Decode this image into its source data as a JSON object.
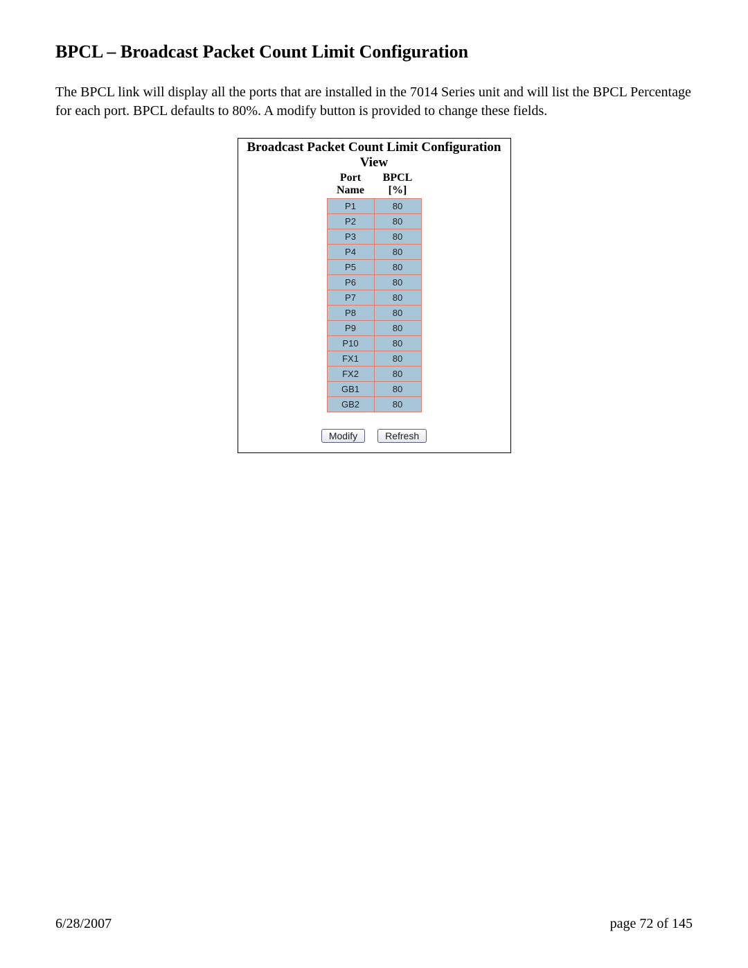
{
  "heading": "BPCL – Broadcast Packet Count Limit Configuration",
  "description": "The BPCL link will display all the ports that are installed in the 7014 Series unit and will list the BPCL Percentage for each port.  BPCL defaults to 80%. A modify button is provided to change these fields.",
  "panel": {
    "title": "Broadcast Packet Count Limit Configuration View",
    "columns": {
      "port": "Port Name",
      "bpcl": "BPCL [%]"
    },
    "rows": [
      {
        "port": "P1",
        "bpcl": "80"
      },
      {
        "port": "P2",
        "bpcl": "80"
      },
      {
        "port": "P3",
        "bpcl": "80"
      },
      {
        "port": "P4",
        "bpcl": "80"
      },
      {
        "port": "P5",
        "bpcl": "80"
      },
      {
        "port": "P6",
        "bpcl": "80"
      },
      {
        "port": "P7",
        "bpcl": "80"
      },
      {
        "port": "P8",
        "bpcl": "80"
      },
      {
        "port": "P9",
        "bpcl": "80"
      },
      {
        "port": "P10",
        "bpcl": "80"
      },
      {
        "port": "FX1",
        "bpcl": "80"
      },
      {
        "port": "FX2",
        "bpcl": "80"
      },
      {
        "port": "GB1",
        "bpcl": "80"
      },
      {
        "port": "GB2",
        "bpcl": "80"
      }
    ],
    "buttons": {
      "modify": "Modify",
      "refresh": "Refresh"
    }
  },
  "footer": {
    "date": "6/28/2007",
    "page": "page 72 of 145"
  }
}
